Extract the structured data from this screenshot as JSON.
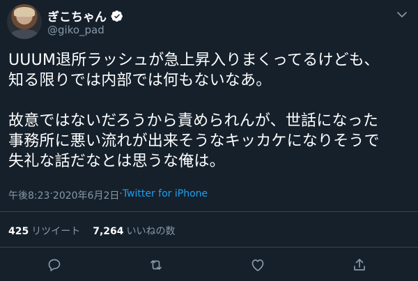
{
  "user": {
    "display_name": "ぎこちゃん",
    "handle": "@giko_pad"
  },
  "tweet": {
    "text": "UUUM退所ラッシュが急上昇入りまくってるけども、\n知る限りでは内部では何もないなあ。\n\n故意ではないだろうから責められんが、世話になった\n事務所に悪い流れが出来そうなキッカケになりそうで\n失礼な話だなとは思うな俺は。",
    "time": "午後8:23",
    "separator": " · ",
    "date": "2020年6月2日",
    "source": "Twitter for iPhone"
  },
  "stats": {
    "retweets_count": "425",
    "retweets_label": "リツイート",
    "likes_count": "7,264",
    "likes_label": "いいねの数"
  },
  "icons": {
    "verified": "verified-badge-icon",
    "more": "chevron-down-icon",
    "reply": "reply-icon",
    "retweet": "retweet-icon",
    "like": "heart-icon",
    "share": "share-icon"
  },
  "colors": {
    "background": "#15202b",
    "muted": "#8899a6",
    "accent": "#1da1f2",
    "divider": "#38444d"
  }
}
